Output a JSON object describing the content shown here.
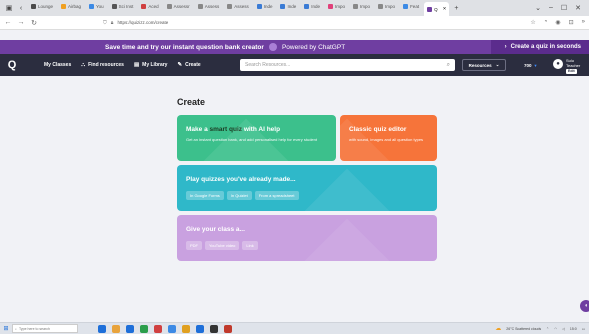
{
  "browser": {
    "tabs": [
      {
        "label": "Lounge",
        "color": "#4a4a4a"
      },
      {
        "label": "Airbag",
        "color": "#f0a020"
      },
      {
        "label": "You",
        "color": "#3c8ae5"
      },
      {
        "label": "Sci Inst",
        "color": "#555555"
      },
      {
        "label": "Aced",
        "color": "#d04040"
      },
      {
        "label": "Assessr",
        "color": "#888888"
      },
      {
        "label": "Assess",
        "color": "#888888"
      },
      {
        "label": "Assess",
        "color": "#888888"
      },
      {
        "label": "Inde",
        "color": "#3a7bd5"
      },
      {
        "label": "Inde",
        "color": "#3a7bd5"
      },
      {
        "label": "Inde",
        "color": "#3a7bd5"
      },
      {
        "label": "Impo",
        "color": "#e0407a"
      },
      {
        "label": "Impo",
        "color": "#888888"
      },
      {
        "label": "Impo",
        "color": "#888888"
      },
      {
        "label": "Feat",
        "color": "#3c8ae5"
      },
      {
        "label": "Q",
        "color": "#6f3ea1",
        "active": true
      }
    ],
    "url": "https://quizizz.com/create",
    "nav_back": "←",
    "nav_forward": "→",
    "nav_reload": "↻"
  },
  "promo": {
    "message": "Save time and try our instant question bank creator",
    "powered": "Powered by ChatGPT",
    "cta": "Create a quiz in seconds"
  },
  "appbar": {
    "logo": "Q",
    "nav": [
      {
        "label": "My Classes",
        "icon": "classes-icon"
      },
      {
        "label": "Find resources",
        "icon": "find-icon"
      },
      {
        "label": "My Library",
        "icon": "library-icon"
      },
      {
        "label": "Create",
        "icon": "create-icon"
      }
    ],
    "search_placeholder": "Search Resources...",
    "resources_label": "Resources",
    "credits": "700",
    "user_name": "Sulu Teacher",
    "user_role": "Edit"
  },
  "create": {
    "title": "Create",
    "cards": {
      "ai": {
        "title_prefix": "Make a ",
        "title_highlight": "smart quiz",
        "title_suffix": " with AI help",
        "desc": "Get an instant question bank, and add personalised help for every student",
        "color": "#3cc08c"
      },
      "classic": {
        "title": "Classic quiz editor",
        "desc": "with sound, images and all question types",
        "color": "#f6743a"
      },
      "import": {
        "title": "Play quizzes you've already made...",
        "chips": [
          "In Google Forms",
          "In Quizlet",
          "From a spreadsheet"
        ],
        "color": "#2fb8c9"
      },
      "class": {
        "title": "Give your class a...",
        "chips": [
          "PDF",
          "YouTube video",
          "Link"
        ],
        "color": "#c9a1e0"
      }
    }
  },
  "taskbar": {
    "search_placeholder": "Type here to search",
    "weather": "26°C Scattered clouds",
    "time": "15:0",
    "apps": [
      "#1e6fd9",
      "#e8a33c",
      "#1e6fd9",
      "#2b9e4b",
      "#d04040",
      "#3c8ae5",
      "#e0a020",
      "#1e6fd9",
      "#333333",
      "#c0392b"
    ]
  }
}
